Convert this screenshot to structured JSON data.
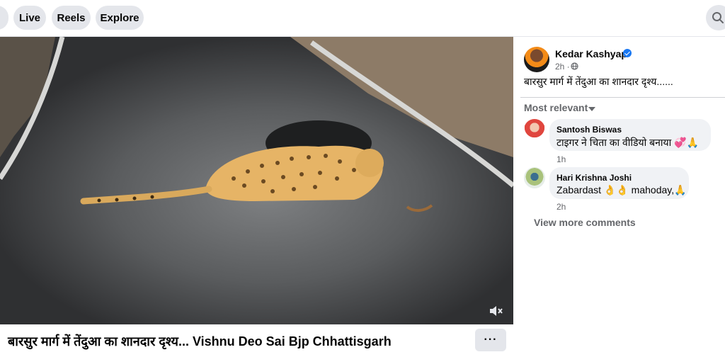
{
  "nav": {
    "tabs": [
      {
        "label": ""
      },
      {
        "label": "Live"
      },
      {
        "label": "Reels"
      },
      {
        "label": "Explore"
      }
    ],
    "search_icon": "search-icon"
  },
  "video": {
    "mute_icon": "speaker-muted-icon",
    "title": "बारसुर मार्ग में तेंदुआ का शानदार दृश्य... Vishnu Deo Sai Bjp Chhattisgarh",
    "more_label": "···"
  },
  "post": {
    "author": "Kedar Kashyap",
    "time": "2h ·",
    "caption": "बारसुर मार्ग में तेंदुआ का शानदार दृश्य......",
    "sort_label": "Most relevant",
    "view_more": "View more comments"
  },
  "comments": [
    {
      "name": "Santosh Biswas",
      "text": "टाइगर ने चिता का वीडियो बनाया 💞🙏",
      "time": "1h"
    },
    {
      "name": "Hari Krishna Joshi",
      "text": "Zabardast 👌👌 mahoday,🙏",
      "time": "2h"
    }
  ],
  "colors": {
    "accent": "#1877f2",
    "secondary_text": "#65676b",
    "bubble": "#f0f2f5",
    "pill": "#e4e6eb"
  }
}
